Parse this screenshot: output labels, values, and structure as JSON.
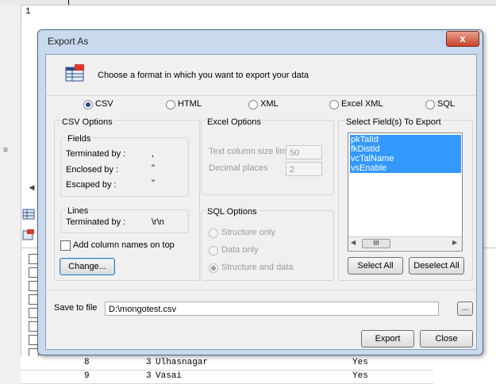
{
  "background": {
    "line_number": "1",
    "rows": [
      {
        "num": "8",
        "id": "3",
        "name": "Ulhasnagar",
        "enable": "Yes"
      },
      {
        "num": "9",
        "id": "3",
        "name": "Vasai",
        "enable": "Yes"
      }
    ]
  },
  "dialog": {
    "title": "Export As",
    "close_label": "x",
    "header_text": "Choose a format in which you want to export your data",
    "formats": [
      "CSV",
      "HTML",
      "XML",
      "Excel XML",
      "SQL"
    ],
    "selected_format": "CSV",
    "csv_options": {
      "title": "CSV Options",
      "fields_title": "Fields",
      "terminated_label": "Terminated by :",
      "terminated_value": ",",
      "enclosed_label": "Enclosed by :",
      "enclosed_value": "\"",
      "escaped_label": "Escaped by :",
      "escaped_value": "\"",
      "lines_title": "Lines",
      "lines_terminated_label": "Terminated by :",
      "lines_terminated_value": "\\r\\n",
      "add_column_names_label": "Add column names on top",
      "change_button": "Change..."
    },
    "excel_options": {
      "title": "Excel Options",
      "col_size_label": "Text column size limit",
      "col_size_value": "50",
      "decimal_label": "Decimal places",
      "decimal_value": "2"
    },
    "sql_options": {
      "title": "SQL Options",
      "structure_only": "Structure only",
      "data_only": "Data only",
      "structure_and_data": "Structure and data"
    },
    "fields": {
      "title": "Select Field(s) To Export",
      "items": [
        "pkTalId",
        "fkDistId",
        "vcTalName",
        "vsEnable"
      ],
      "scroll_thumb": "III",
      "select_all": "Select All",
      "deselect_all": "Deselect All"
    },
    "save": {
      "label": "Save to file",
      "value": "D:\\mongotest.csv",
      "browse": "..."
    },
    "export_button": "Export",
    "close_button": "Close"
  }
}
